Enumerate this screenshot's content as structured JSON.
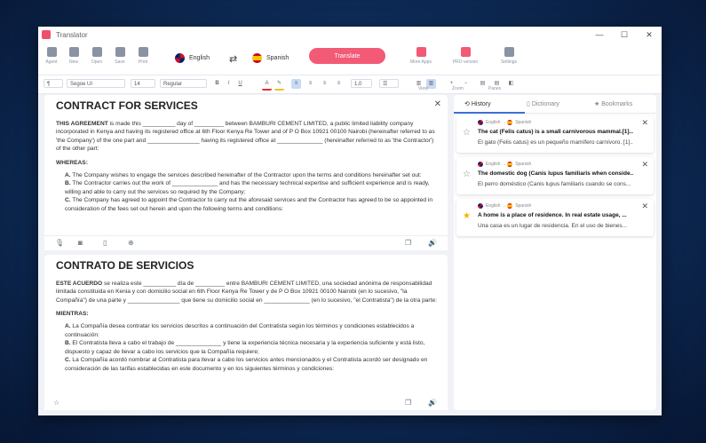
{
  "window": {
    "title": "Translator",
    "controls": [
      "—",
      "☐",
      "✕"
    ]
  },
  "toolbar": {
    "left": [
      "Agent",
      "New",
      "Open",
      "Save",
      "Print"
    ],
    "source_lang": "English",
    "target_lang": "Spanish",
    "swap_symbol": "⇄",
    "translate_label": "Translate",
    "right": [
      "More Apps",
      "PRO version",
      "Settings"
    ]
  },
  "format": {
    "paragraph": "¶",
    "font": "Segoe UI",
    "size": "14",
    "style": "Regular",
    "bold": "B",
    "italic": "I",
    "underline": "U",
    "spacing": "1,0",
    "view_label": "View",
    "zoom_plus": "+",
    "zoom_minus": "−",
    "zoom_label": "Zoom",
    "panes_label": "Panes"
  },
  "source_doc": {
    "title": "CONTRACT FOR SERVICES",
    "p1_bold": "THIS AGREEMENT",
    "p1": " is made this __________ day of _________ between BAMBURI CEMENT LIMITED, a public limited liability company incorporated in Kenya and having its registered office at 6th Floor Kenya Re Tower and of P O Box 10921 00100 Nairobi (hereinafter referred to as 'the Company') of the one part and ________________ having its registered office at ______________ (hereinafter referred to as 'the Contractor') of the other part:",
    "whereas": "WHEREAS:",
    "items": [
      {
        "k": "A.",
        "t": " The Company wishes to engage the services described hereinafter of the Contractor upon the terms and conditions hereinafter    set out:"
      },
      {
        "k": "B.",
        "t": " The Contractor carries out the work of ______________ and has the necessary technical expertise and sufficient experience and   is ready, willing and able to carry out the services so required by the Company;"
      },
      {
        "k": "C.",
        "t": " The Company has agreed to appoint the Contractor to carry out the aforesaid services and the Contractor has agreed to be so appointed in consideration of the fees set out herein and upon the following terms and conditions:"
      }
    ]
  },
  "target_doc": {
    "title": "CONTRATO DE SERVICIOS",
    "p1_bold": "ESTE ACUERDO",
    "p1": " se realiza este __________ día de _________ entre BAMBURI CEMENT LIMITED, una sociedad anónima de responsabilidad limitada constituida en Kenia y con domicilio social en 6th Floor Kenya Re Tower y de P O Box 10921 00100 Nairobi (en lo sucesivo, \"la Compañía\") de una parte y ________________ que tiene su domicilio social en ______________ (en lo sucesivo, \"el Contratista\") de la otra parte:",
    "whereas": "MIENTRAS:",
    "items": [
      {
        "k": "A.",
        "t": " La Compañía desea contratar los servicios descritos a continuación del Contratista según los términos y condiciones establecidos       a continuación:"
      },
      {
        "k": "B.",
        "t": " El Contratista lleva a cabo el trabajo de ______________ y tiene la experiencia técnica necesaria y la experiencia suficiente y está listo, dispuesto y capaz de llevar a cabo los servicios que la Compañía requiere;"
      },
      {
        "k": "C.",
        "t": " La Compañía acordó nombrar al Contratista para llevar a cabo los servicios antes mencionados y el Contratista acordó ser designado en consideración de las tarifas establecidas en este documento y en los siguientes términos y condiciones:"
      }
    ]
  },
  "side": {
    "tabs": [
      "History",
      "Dictionary",
      "Bookmarks"
    ],
    "dir_from": "English",
    "dir_arrow": "→",
    "dir_to": "Spanish",
    "history": [
      {
        "src": "The cat (Felis catus) is a small carnivorous mammal.[1]...",
        "tgt": "El gato (Felis catus) es un pequeño mamífero carnívoro. [1]..."
      },
      {
        "src": "The domestic dog (Canis lupus familiaris when conside...",
        "tgt": "El perro doméstico (Canis lupus familiaris cuando se cons..."
      },
      {
        "src": "A home is a place of residence. In real estate usage, ...",
        "tgt": "Una casa es un lugar de residencia. En el uso de bienes..."
      }
    ]
  },
  "colors": {
    "accent": "#f25a75",
    "select": "#3b6fd8",
    "star": "#f5b400"
  }
}
